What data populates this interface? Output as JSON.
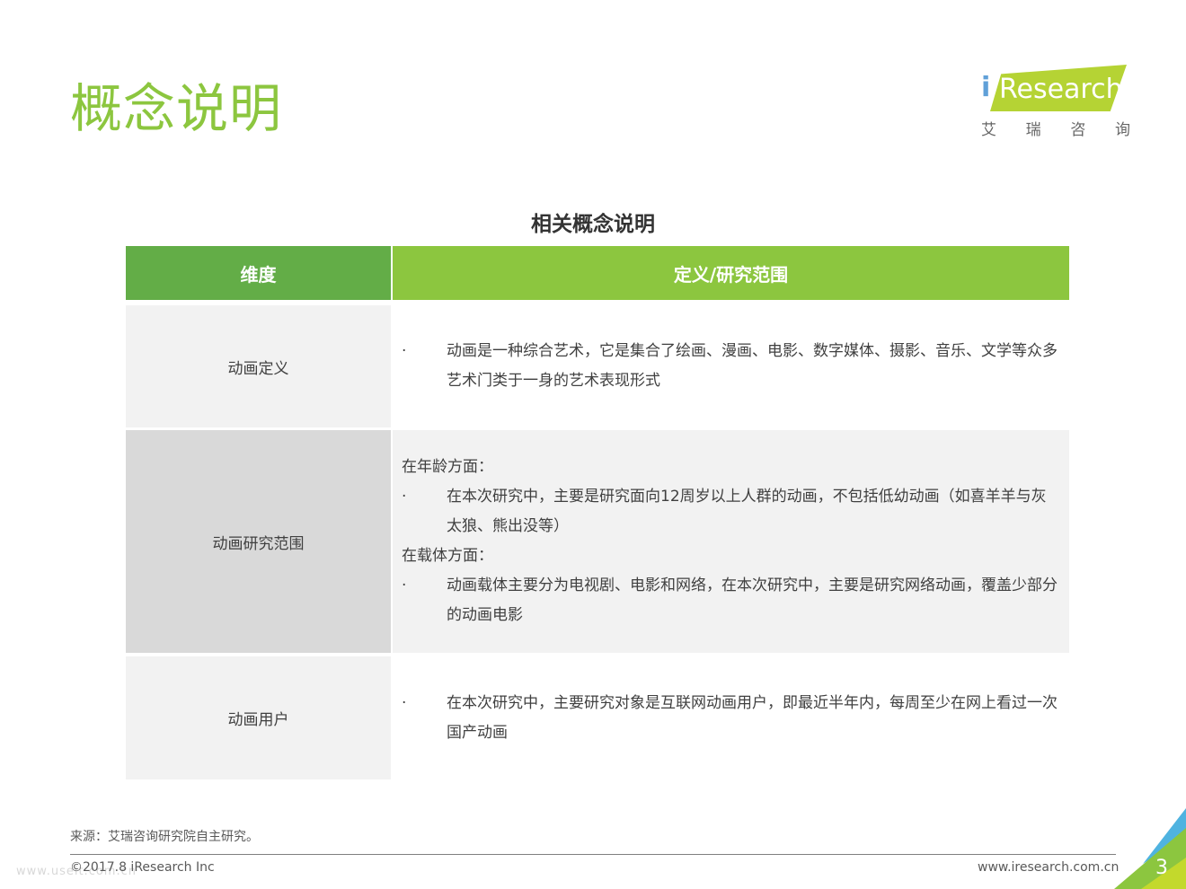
{
  "page": {
    "title": "概念说明",
    "subtitle": "相关概念说明",
    "page_number": "3"
  },
  "logo": {
    "brand": "iResearch",
    "i": "i",
    "rest": "Research",
    "cn": [
      "艾",
      "瑞",
      "咨",
      "询"
    ]
  },
  "table": {
    "headers": [
      "维度",
      "定义/研究范围"
    ],
    "rows": [
      {
        "dimension": "动画定义",
        "content": [
          {
            "type": "bullet",
            "text": "动画是一种综合艺术，它是集合了绘画、漫画、电影、数字媒体、摄影、音乐、文学等众多艺术门类于一身的艺术表现形式"
          }
        ]
      },
      {
        "dimension": "动画研究范围",
        "content": [
          {
            "type": "heading",
            "text": "在年龄方面："
          },
          {
            "type": "bullet",
            "text": "在本次研究中，主要是研究面向12周岁以上人群的动画，不包括低幼动画（如喜羊羊与灰太狼、熊出没等）"
          },
          {
            "type": "heading",
            "text": "在载体方面："
          },
          {
            "type": "bullet",
            "text": "动画载体主要分为电视剧、电影和网络，在本次研究中，主要是研究网络动画，覆盖少部分的动画电影"
          }
        ]
      },
      {
        "dimension": "动画用户",
        "content": [
          {
            "type": "bullet",
            "text": "在本次研究中，主要研究对象是互联网动画用户，即最近半年内，每周至少在网上看过一次国产动画"
          }
        ]
      }
    ],
    "bullet_char": "·"
  },
  "footer": {
    "source": "来源：艾瑞咨询研究院自主研究。",
    "copyright": "©2017.8 iResearch Inc",
    "url": "www.iresearch.com.cn",
    "watermark": "www.useit.com.cn"
  },
  "colors": {
    "title": "#8cc63f",
    "header_dim": "#63ad47",
    "header_def": "#8cc63f"
  }
}
